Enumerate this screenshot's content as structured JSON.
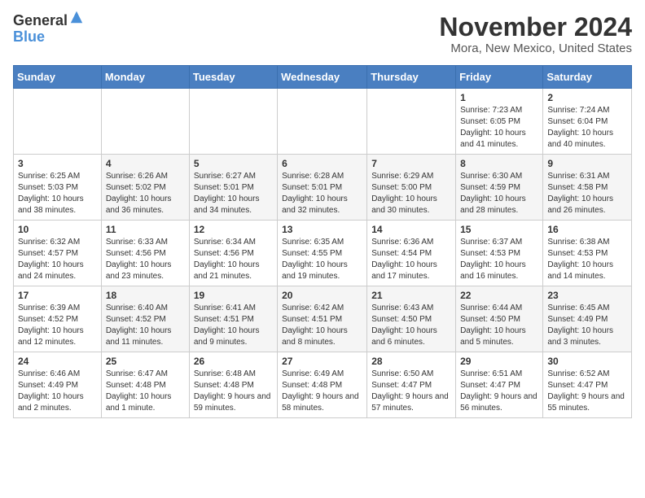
{
  "logo": {
    "general": "General",
    "blue": "Blue"
  },
  "header": {
    "month": "November 2024",
    "location": "Mora, New Mexico, United States"
  },
  "weekdays": [
    "Sunday",
    "Monday",
    "Tuesday",
    "Wednesday",
    "Thursday",
    "Friday",
    "Saturday"
  ],
  "weeks": [
    [
      {
        "day": "",
        "info": ""
      },
      {
        "day": "",
        "info": ""
      },
      {
        "day": "",
        "info": ""
      },
      {
        "day": "",
        "info": ""
      },
      {
        "day": "",
        "info": ""
      },
      {
        "day": "1",
        "info": "Sunrise: 7:23 AM\nSunset: 6:05 PM\nDaylight: 10 hours and 41 minutes."
      },
      {
        "day": "2",
        "info": "Sunrise: 7:24 AM\nSunset: 6:04 PM\nDaylight: 10 hours and 40 minutes."
      }
    ],
    [
      {
        "day": "3",
        "info": "Sunrise: 6:25 AM\nSunset: 5:03 PM\nDaylight: 10 hours and 38 minutes."
      },
      {
        "day": "4",
        "info": "Sunrise: 6:26 AM\nSunset: 5:02 PM\nDaylight: 10 hours and 36 minutes."
      },
      {
        "day": "5",
        "info": "Sunrise: 6:27 AM\nSunset: 5:01 PM\nDaylight: 10 hours and 34 minutes."
      },
      {
        "day": "6",
        "info": "Sunrise: 6:28 AM\nSunset: 5:01 PM\nDaylight: 10 hours and 32 minutes."
      },
      {
        "day": "7",
        "info": "Sunrise: 6:29 AM\nSunset: 5:00 PM\nDaylight: 10 hours and 30 minutes."
      },
      {
        "day": "8",
        "info": "Sunrise: 6:30 AM\nSunset: 4:59 PM\nDaylight: 10 hours and 28 minutes."
      },
      {
        "day": "9",
        "info": "Sunrise: 6:31 AM\nSunset: 4:58 PM\nDaylight: 10 hours and 26 minutes."
      }
    ],
    [
      {
        "day": "10",
        "info": "Sunrise: 6:32 AM\nSunset: 4:57 PM\nDaylight: 10 hours and 24 minutes."
      },
      {
        "day": "11",
        "info": "Sunrise: 6:33 AM\nSunset: 4:56 PM\nDaylight: 10 hours and 23 minutes."
      },
      {
        "day": "12",
        "info": "Sunrise: 6:34 AM\nSunset: 4:56 PM\nDaylight: 10 hours and 21 minutes."
      },
      {
        "day": "13",
        "info": "Sunrise: 6:35 AM\nSunset: 4:55 PM\nDaylight: 10 hours and 19 minutes."
      },
      {
        "day": "14",
        "info": "Sunrise: 6:36 AM\nSunset: 4:54 PM\nDaylight: 10 hours and 17 minutes."
      },
      {
        "day": "15",
        "info": "Sunrise: 6:37 AM\nSunset: 4:53 PM\nDaylight: 10 hours and 16 minutes."
      },
      {
        "day": "16",
        "info": "Sunrise: 6:38 AM\nSunset: 4:53 PM\nDaylight: 10 hours and 14 minutes."
      }
    ],
    [
      {
        "day": "17",
        "info": "Sunrise: 6:39 AM\nSunset: 4:52 PM\nDaylight: 10 hours and 12 minutes."
      },
      {
        "day": "18",
        "info": "Sunrise: 6:40 AM\nSunset: 4:52 PM\nDaylight: 10 hours and 11 minutes."
      },
      {
        "day": "19",
        "info": "Sunrise: 6:41 AM\nSunset: 4:51 PM\nDaylight: 10 hours and 9 minutes."
      },
      {
        "day": "20",
        "info": "Sunrise: 6:42 AM\nSunset: 4:51 PM\nDaylight: 10 hours and 8 minutes."
      },
      {
        "day": "21",
        "info": "Sunrise: 6:43 AM\nSunset: 4:50 PM\nDaylight: 10 hours and 6 minutes."
      },
      {
        "day": "22",
        "info": "Sunrise: 6:44 AM\nSunset: 4:50 PM\nDaylight: 10 hours and 5 minutes."
      },
      {
        "day": "23",
        "info": "Sunrise: 6:45 AM\nSunset: 4:49 PM\nDaylight: 10 hours and 3 minutes."
      }
    ],
    [
      {
        "day": "24",
        "info": "Sunrise: 6:46 AM\nSunset: 4:49 PM\nDaylight: 10 hours and 2 minutes."
      },
      {
        "day": "25",
        "info": "Sunrise: 6:47 AM\nSunset: 4:48 PM\nDaylight: 10 hours and 1 minute."
      },
      {
        "day": "26",
        "info": "Sunrise: 6:48 AM\nSunset: 4:48 PM\nDaylight: 9 hours and 59 minutes."
      },
      {
        "day": "27",
        "info": "Sunrise: 6:49 AM\nSunset: 4:48 PM\nDaylight: 9 hours and 58 minutes."
      },
      {
        "day": "28",
        "info": "Sunrise: 6:50 AM\nSunset: 4:47 PM\nDaylight: 9 hours and 57 minutes."
      },
      {
        "day": "29",
        "info": "Sunrise: 6:51 AM\nSunset: 4:47 PM\nDaylight: 9 hours and 56 minutes."
      },
      {
        "day": "30",
        "info": "Sunrise: 6:52 AM\nSunset: 4:47 PM\nDaylight: 9 hours and 55 minutes."
      }
    ]
  ]
}
